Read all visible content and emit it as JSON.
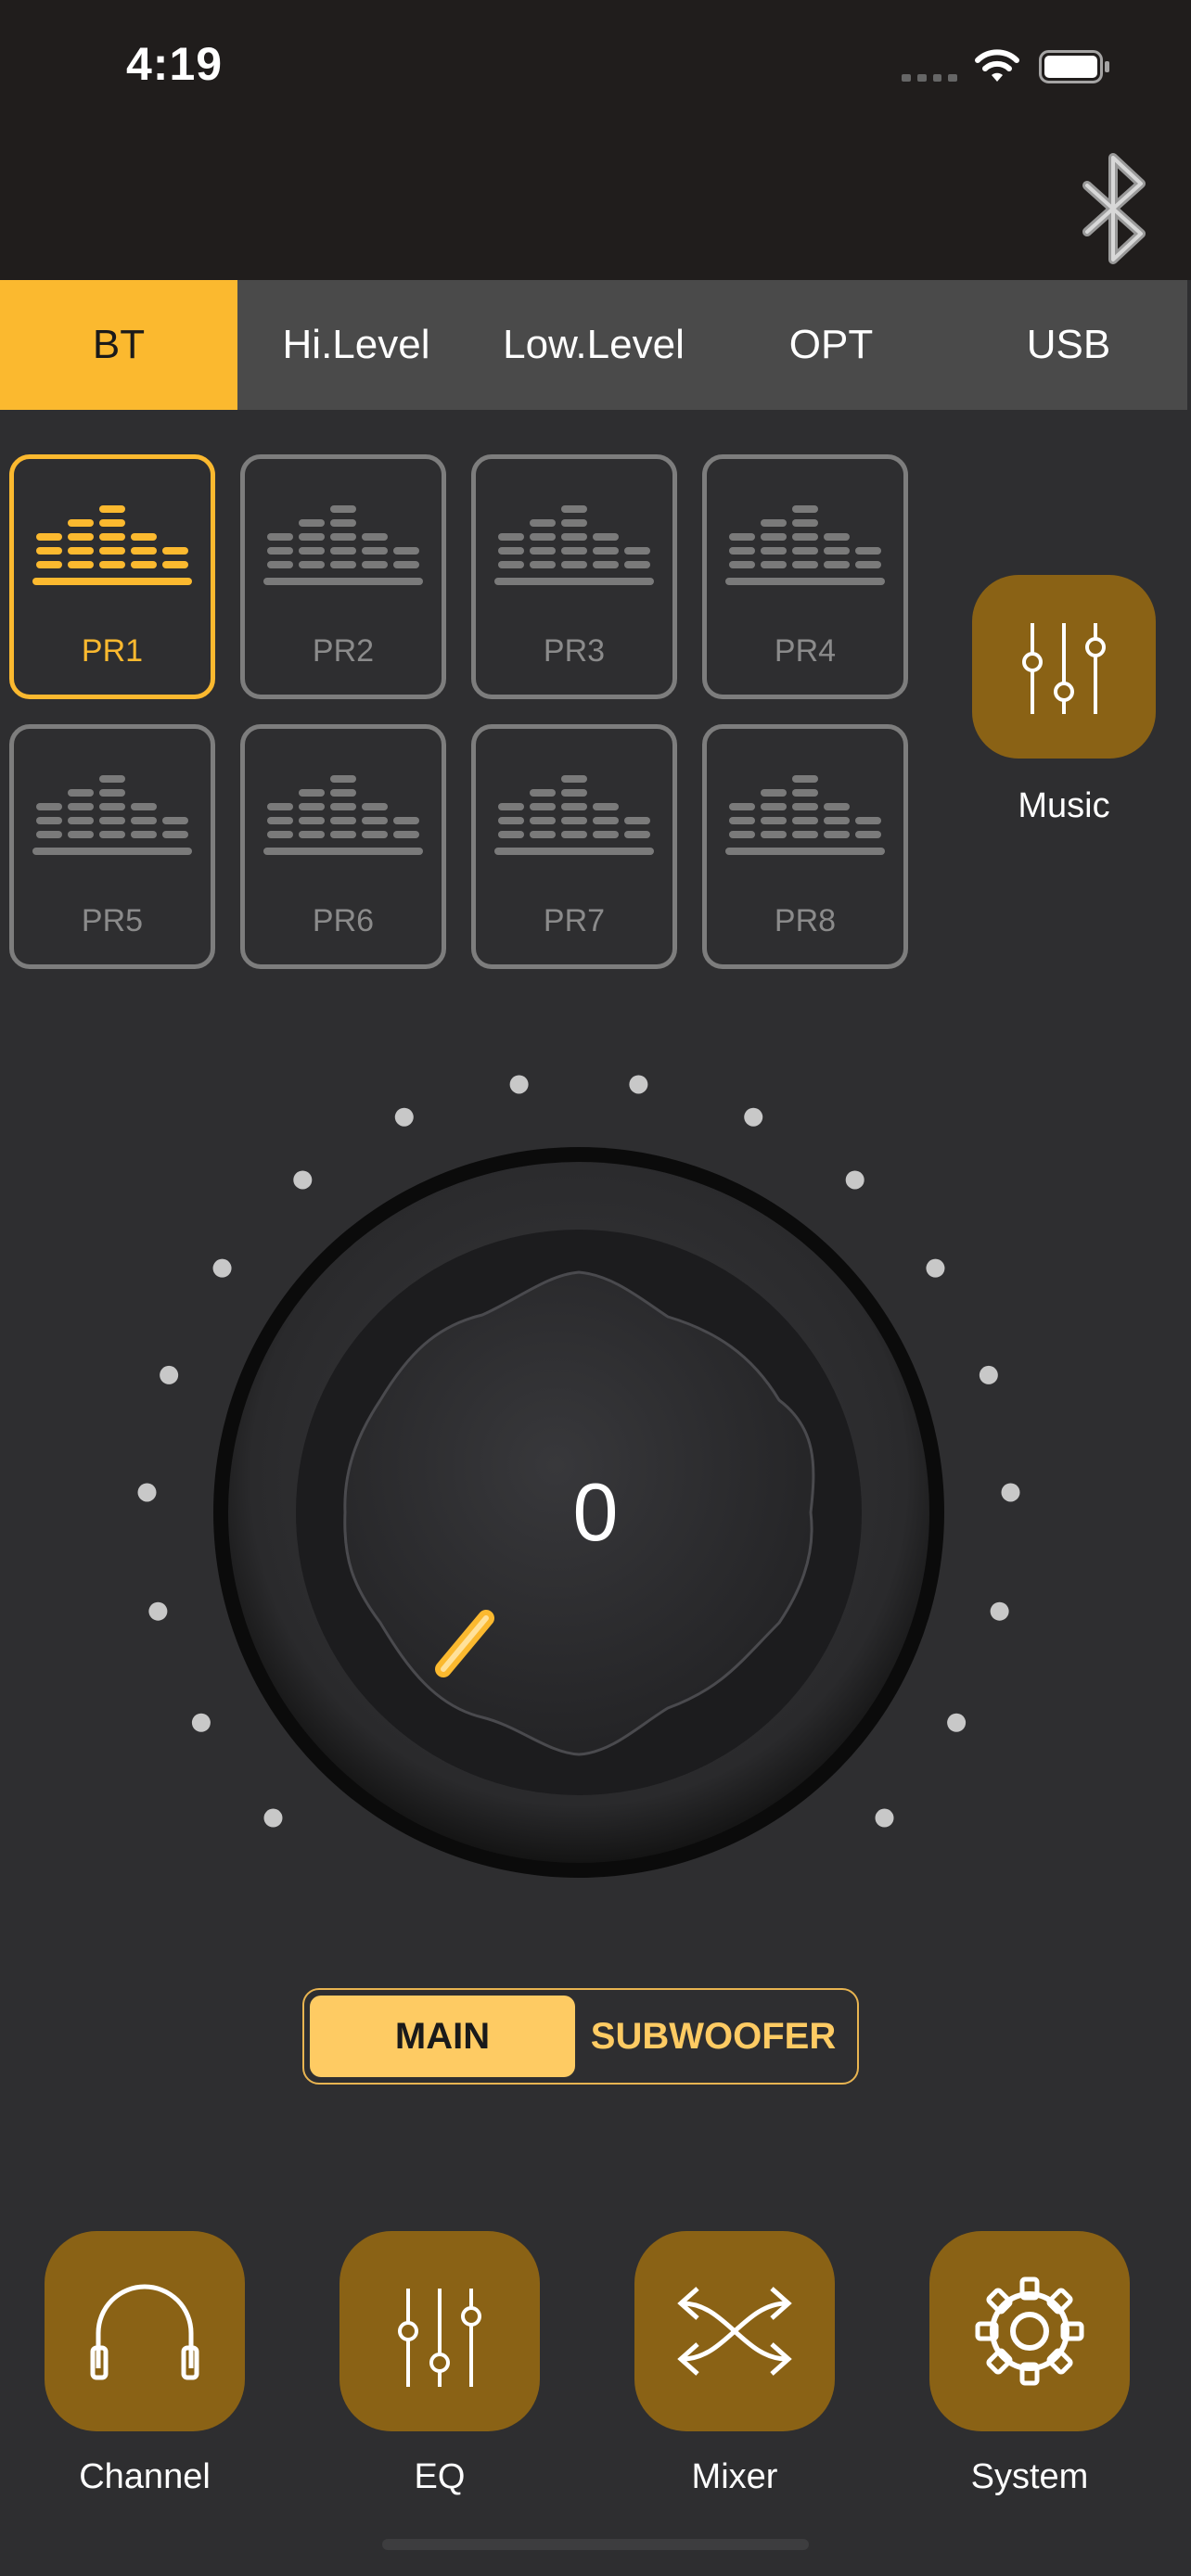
{
  "status_bar": {
    "time": "4:19",
    "icons": [
      "cellular-signal-icon",
      "wifi-icon",
      "battery-icon"
    ]
  },
  "header": {
    "icon": "bluetooth-icon"
  },
  "tabs": [
    {
      "label": "BT",
      "active": true
    },
    {
      "label": "Hi.Level",
      "active": false
    },
    {
      "label": "Low.Level",
      "active": false
    },
    {
      "label": "OPT",
      "active": false
    },
    {
      "label": "USB",
      "active": false
    }
  ],
  "presets": [
    {
      "label": "PR1",
      "active": true
    },
    {
      "label": "PR2",
      "active": false
    },
    {
      "label": "PR3",
      "active": false
    },
    {
      "label": "PR4",
      "active": false
    },
    {
      "label": "PR5",
      "active": false
    },
    {
      "label": "PR6",
      "active": false
    },
    {
      "label": "PR7",
      "active": false
    },
    {
      "label": "PR8",
      "active": false
    }
  ],
  "music": {
    "label": "Music",
    "icon": "sliders-icon"
  },
  "knob": {
    "value": "0"
  },
  "output_select": {
    "main_label": "MAIN",
    "sub_label": "SUBWOOFER",
    "selected": "MAIN"
  },
  "bottom_nav": [
    {
      "label": "Channel",
      "icon": "headphones-icon"
    },
    {
      "label": "EQ",
      "icon": "sliders-icon"
    },
    {
      "label": "Mixer",
      "icon": "shuffle-icon"
    },
    {
      "label": "System",
      "icon": "gear-icon"
    }
  ],
  "colors": {
    "accent": "#fbb92f",
    "button_bg": "#8a6215",
    "background": "#2e2e30",
    "header_bg": "#201d1c",
    "tab_bar_bg": "#4a4a4a",
    "inactive_preset": "#7d7d7d"
  }
}
